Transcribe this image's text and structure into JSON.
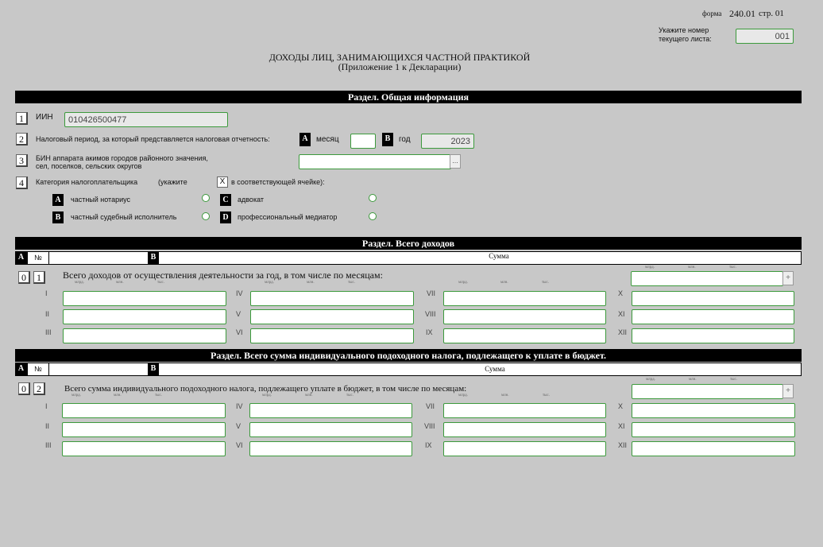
{
  "header": {
    "form_label": "форма",
    "form_code": "240.01",
    "page_label": "стр. 01",
    "sheet_label_1": "Укажите номер",
    "sheet_label_2": "текущего листа:",
    "sheet_number": "001",
    "title": "ДОХОДЫ ЛИЦ, ЗАНИМАЮЩИХСЯ ЧАСТНОЙ ПРАКТИКОЙ",
    "subtitle": "(Приложение 1 к Декларации)"
  },
  "general": {
    "section_title": "Раздел. Общая информация",
    "f1_num": "1",
    "f1_label": "ИИН",
    "iin_value": "010426500477",
    "f2_num": "2",
    "f2_label": "Налоговый период, за который представляется налоговая отчетность:",
    "tag_a": "A",
    "month_label": "месяц",
    "tag_b": "B",
    "year_label": "год",
    "year_value": "2023",
    "f3_num": "3",
    "f3_label_1": "БИН аппарата акимов городов районного значения,",
    "f3_label_2": "сел, поселков, сельских округов",
    "dots": "...",
    "f4_num": "4",
    "f4_label": "Категория налогоплательщика",
    "f4_hint_1": "(укажите",
    "f4_hint_x": "X",
    "f4_hint_2": "в соответствующей ячейке):",
    "categories": [
      {
        "tag": "A",
        "label": "частный нотариус"
      },
      {
        "tag": "B",
        "label": "частный судебный исполнитель"
      },
      {
        "tag": "C",
        "label": "адвокат"
      },
      {
        "tag": "D",
        "label": "профессиональный медиатор"
      }
    ]
  },
  "income": {
    "section_title": "Раздел. Всего доходов",
    "col_a": "A",
    "col_no": "№",
    "col_b": "B",
    "col_sum": "Сумма",
    "code_1": "0",
    "code_2": "1",
    "row_label": "Всего доходов от осуществления деятельности за год, в том числе по месяцам:",
    "plus": "+"
  },
  "tax": {
    "section_title": "Раздел. Всего сумма индивидуального подоходного налога, подлежащего к уплате в бюджет.",
    "col_a": "A",
    "col_no": "№",
    "col_b": "B",
    "col_sum": "Сумма",
    "code_1": "0",
    "code_2": "2",
    "row_label": "Всего сумма индивидуального подоходного налога, подлежащего уплате в бюджет, в том числе по месяцам:",
    "plus": "+"
  },
  "units": {
    "bln": "млрд.",
    "mln": "млн.",
    "thous": "тыс."
  },
  "months": [
    "I",
    "II",
    "III",
    "IV",
    "V",
    "VI",
    "VII",
    "VIII",
    "IX",
    "X",
    "XI",
    "XII"
  ]
}
